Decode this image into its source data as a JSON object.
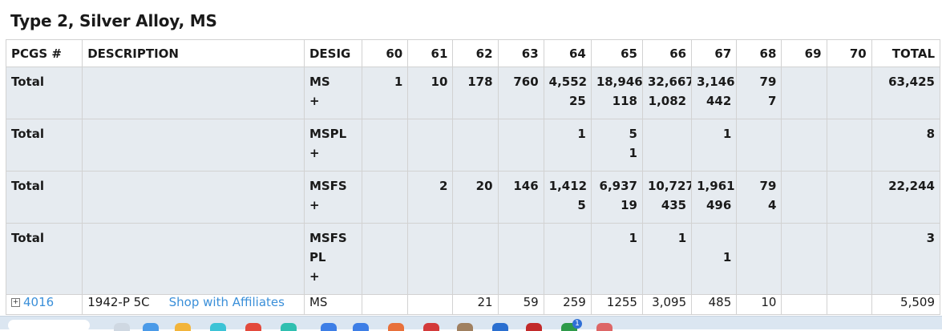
{
  "title": "Type 2, Silver Alloy, MS",
  "columns": [
    "PCGS #",
    "DESCRIPTION",
    "DESIG",
    "60",
    "61",
    "62",
    "63",
    "64",
    "65",
    "66",
    "67",
    "68",
    "69",
    "70",
    "TOTAL"
  ],
  "rows": [
    {
      "pcgs": "Total",
      "desc": "",
      "desig": [
        "MS",
        "+"
      ],
      "grades": [
        [
          "1"
        ],
        [
          "10"
        ],
        [
          "178"
        ],
        [
          "760"
        ],
        [
          "4,552",
          "25"
        ],
        [
          "18,946",
          "118"
        ],
        [
          "32,667",
          "1,082"
        ],
        [
          "3,146",
          "442"
        ],
        [
          "79",
          "7"
        ],
        [],
        []
      ],
      "total": "63,425"
    },
    {
      "pcgs": "Total",
      "desc": "",
      "desig": [
        "MSPL",
        "+"
      ],
      "grades": [
        [],
        [],
        [],
        [],
        [
          "1"
        ],
        [
          "5",
          "1"
        ],
        [],
        [
          "1"
        ],
        [],
        [],
        []
      ],
      "total": "8"
    },
    {
      "pcgs": "Total",
      "desc": "",
      "desig": [
        "MSFS",
        "+"
      ],
      "grades": [
        [],
        [
          "2"
        ],
        [
          "20"
        ],
        [
          "146"
        ],
        [
          "1,412",
          "5"
        ],
        [
          "6,937",
          "19"
        ],
        [
          "10,727",
          "435"
        ],
        [
          "1,961",
          "496"
        ],
        [
          "79",
          "4"
        ],
        [],
        []
      ],
      "total": "22,244"
    },
    {
      "pcgs": "Total",
      "desc": "",
      "desig": [
        "MSFS",
        "PL",
        "+"
      ],
      "grades": [
        [],
        [],
        [],
        [],
        [],
        [
          "1"
        ],
        [
          "1"
        ],
        [
          "",
          "1"
        ],
        [],
        [],
        []
      ],
      "total": "3"
    }
  ],
  "coin_row": {
    "expander": "+",
    "pcgs": "4016",
    "desc": "1942-P 5C",
    "link": "Shop with Affiliates",
    "desig": "MS",
    "grades": [
      "",
      "",
      "21",
      "59",
      "259",
      "1255",
      "3,095",
      "485",
      "10",
      "",
      ""
    ],
    "total": "5,509"
  },
  "taskbar": {
    "notification_count": "1"
  },
  "colors": {
    "total_row_bg": "#e6ebf0",
    "link": "#3a8fd9",
    "border": "#d2d2d2"
  }
}
